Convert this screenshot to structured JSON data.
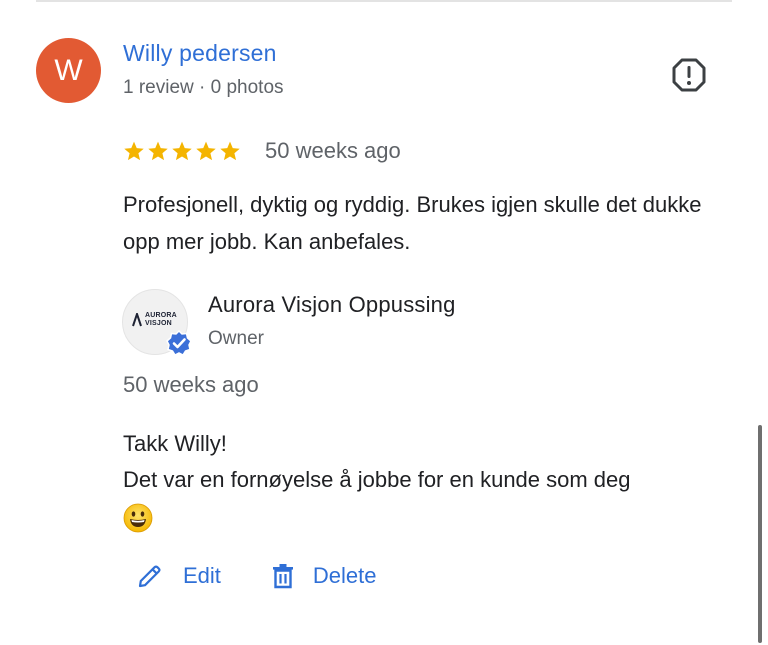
{
  "review": {
    "avatar_letter": "W",
    "reviewer_name": "Willy pedersen",
    "reviewer_meta": "1 review · 0 photos",
    "rating": 5,
    "rating_max": 5,
    "star_color": "#f4b400",
    "age": "50 weeks ago",
    "text": "Profesjonell, dyktig og ryddig. Brukes igjen skulle det dukke opp mer jobb. Kan anbefales."
  },
  "owner_reply": {
    "logo_text_line1": "AURORA",
    "logo_text_line2": "VISJON",
    "name": "Aurora Visjon Oppussing",
    "role": "Owner",
    "age": "50 weeks ago",
    "line1": "Takk Willy!",
    "line2": "Det var en fornøyelse å jobbe for en kunde som deg",
    "emoji_icon": "grinning-face-emoji"
  },
  "actions": {
    "edit_label": "Edit",
    "delete_label": "Delete"
  },
  "colors": {
    "accent": "#2f6fd6",
    "avatar_bg": "#e25a33",
    "verified_badge": "#3b6fd8"
  }
}
